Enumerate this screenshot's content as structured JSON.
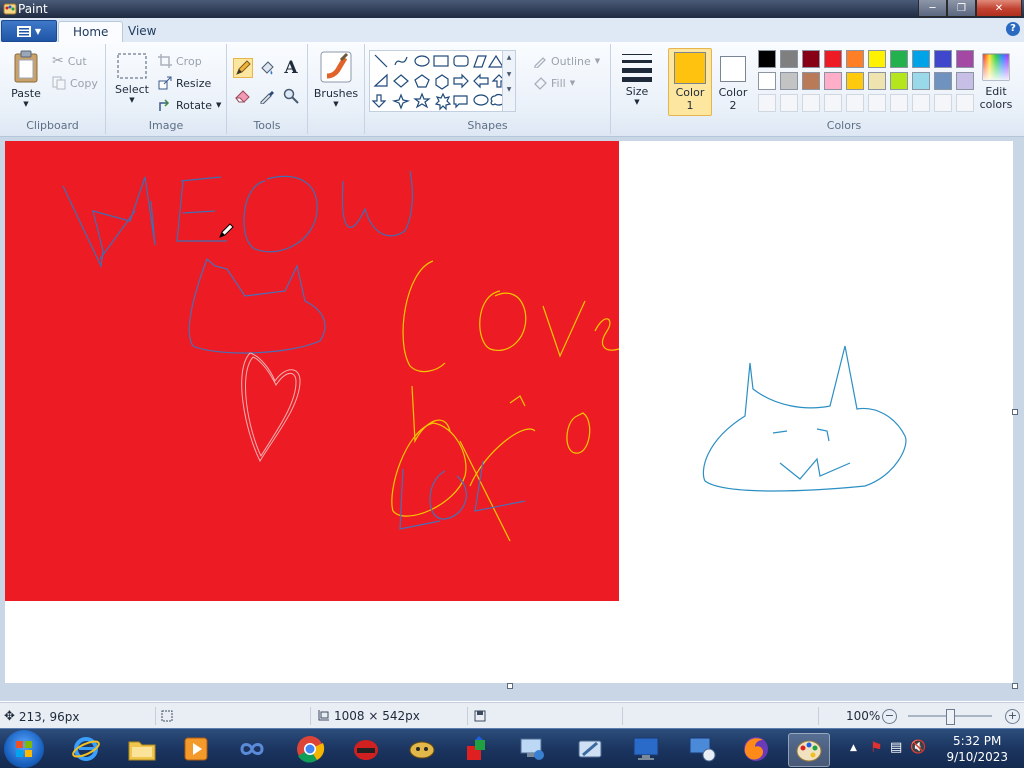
{
  "window": {
    "title": "Paint"
  },
  "tabs": [
    {
      "label": "Home"
    },
    {
      "label": "View"
    }
  ],
  "help": "?",
  "clipboard": {
    "label": "Clipboard",
    "paste": "Paste",
    "cut": "Cut",
    "copy": "Copy"
  },
  "image": {
    "label": "Image",
    "select": "Select",
    "crop": "Crop",
    "resize": "Resize",
    "rotate": "Rotate"
  },
  "tools": {
    "label": "Tools",
    "text_tool": "A"
  },
  "brushes": {
    "label": "Brushes"
  },
  "shapes": {
    "label": "Shapes",
    "outline": "Outline",
    "fill": "Fill"
  },
  "size": {
    "label": "Size"
  },
  "colors": {
    "label": "Colors",
    "color1_label_a": "Color",
    "color1_label_b": "1",
    "color2_label_a": "Color",
    "color2_label_b": "2",
    "edit_a": "Edit",
    "edit_b": "colors",
    "color1": "#ffc20e",
    "color2": "#ffffff",
    "palette_row1": [
      "#000000",
      "#7f7f7f",
      "#880015",
      "#ed1c24",
      "#ff7f27",
      "#fff200",
      "#22b14c",
      "#00a2e8",
      "#3f48cc",
      "#a349a4"
    ],
    "palette_row2": [
      "#ffffff",
      "#c3c3c3",
      "#b97a57",
      "#ffaec9",
      "#ffc90e",
      "#efe4b0",
      "#b5e61d",
      "#99d9ea",
      "#7092be",
      "#c8bfe7"
    ]
  },
  "canvas": {
    "red_fill": "#ed1c24"
  },
  "status": {
    "cursor_pos": "213, 96px",
    "image_size": "1008 × 542px",
    "zoom": "100%"
  },
  "taskbar": {
    "time": "5:32 PM",
    "date": "9/10/2023"
  }
}
